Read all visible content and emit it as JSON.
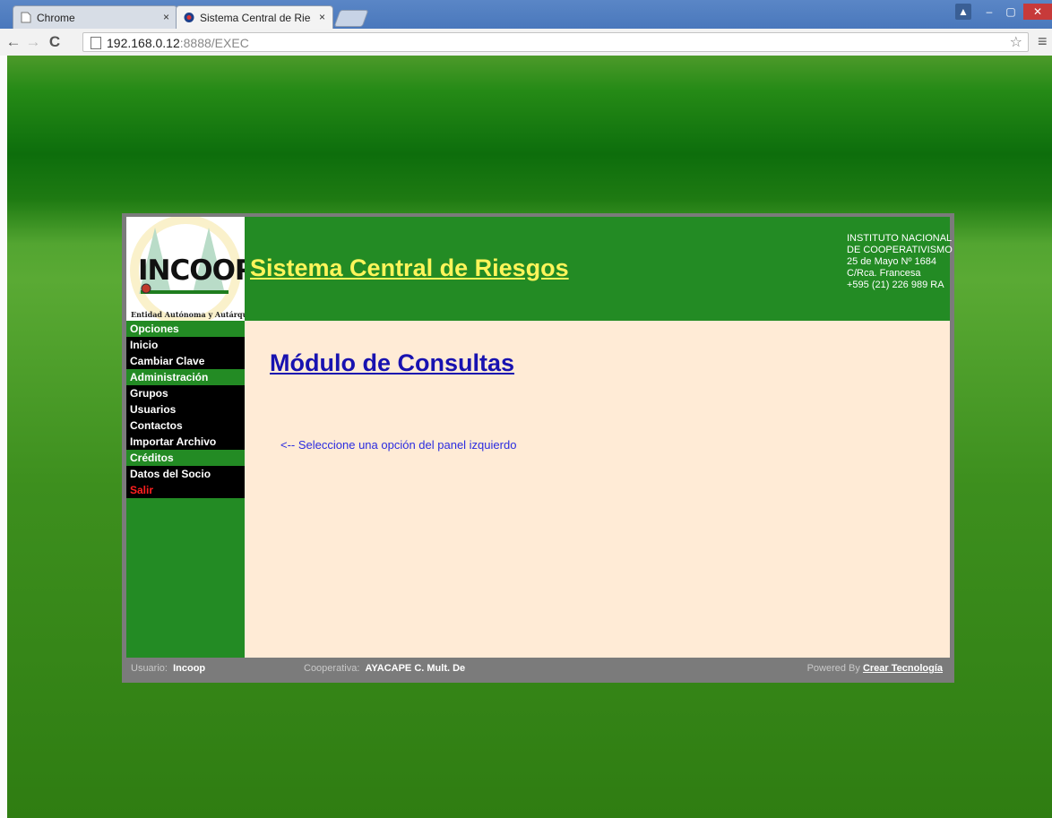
{
  "browser": {
    "tabs": [
      {
        "label": "Chrome",
        "active": false
      },
      {
        "label": "Sistema Central de Riesgo",
        "active": true
      }
    ],
    "url_host": "192.168.0.12",
    "url_rest": ":8888/EXEC",
    "close_glyph": "×"
  },
  "header": {
    "logo_text": "INCOOP",
    "logo_subtitle": "Entidad Autónoma y Autárquica",
    "title": "Sistema Central de Riesgos",
    "institution": {
      "line1": "INSTITUTO NACIONAL",
      "line2": "DE COOPERATIVISMO",
      "line3": "25 de Mayo Nº 1684",
      "line4": "C/Rca. Francesa",
      "line5": "+595 (21) 226 989 RA"
    },
    "title_color": "#fff55a",
    "header_color": "#238b24"
  },
  "sidebar": {
    "sections": [
      {
        "label": "Opciones",
        "items": [
          {
            "label": "Inicio"
          },
          {
            "label": "Cambiar Clave"
          }
        ]
      },
      {
        "label": "Administración",
        "items": [
          {
            "label": "Grupos"
          },
          {
            "label": "Usuarios"
          },
          {
            "label": "Contactos"
          },
          {
            "label": "Importar Archivo"
          }
        ]
      },
      {
        "label": "Créditos",
        "items": [
          {
            "label": "Datos del Socio"
          },
          {
            "label": "Salir"
          }
        ]
      }
    ]
  },
  "main": {
    "title": "Módulo de Consultas",
    "hint": "<-- Seleccione una opción del panel izquierdo"
  },
  "footer": {
    "user_label": "Usuario:",
    "user_value": "Incoop",
    "coop_label": "Cooperativa:",
    "coop_value": "AYACAPE C. Mult. De",
    "powered_label": "Powered By",
    "powered_link": "Crear Tecnología"
  }
}
